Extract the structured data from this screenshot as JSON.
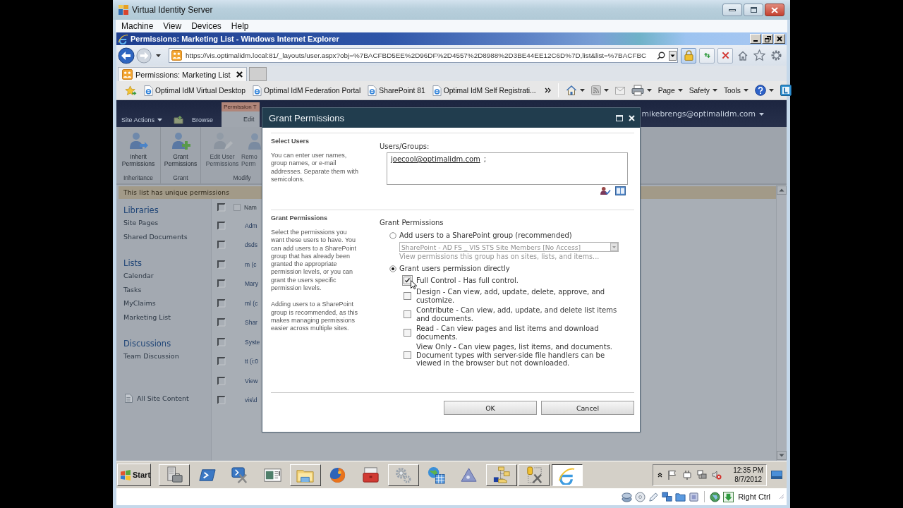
{
  "vm_window": {
    "title": "Virtual Identity Server",
    "menu": [
      "Machine",
      "View",
      "Devices",
      "Help"
    ]
  },
  "browser": {
    "title": "Permissions: Marketing List - Windows Internet Explorer",
    "address": "https://vis.optimalidm.local:81/_layouts/user.aspx?obj=%7BACFBD5EE%2D96DF%2D4557%2D8988%2D3BE44EE12C6D%7D,list&list=%7BACFBC",
    "tabs": [
      {
        "label": "Permissions: Marketing List",
        "selected": true
      }
    ],
    "favorites": [
      "Optimal IdM Virtual Desktop",
      "Optimal IdM Federation Portal",
      "SharePoint 81",
      "Optimal IdM Self Registrati..."
    ],
    "commands": [
      "Page",
      "Safety",
      "Tools"
    ]
  },
  "sharepoint": {
    "site_actions": "Site Actions",
    "ribbon_tabs": [
      {
        "label": "Browse",
        "selected": false
      }
    ],
    "contextual_group": {
      "title": "Permission T",
      "tabs": [
        {
          "label": "Edit",
          "selected": true
        }
      ]
    },
    "user": "mikebrengs@optimalidm.com",
    "ribbon_groups": [
      {
        "label": "Inheritance",
        "buttons": [
          {
            "kind": "inherit",
            "label": "Inherit Permissions",
            "disabled": false
          }
        ]
      },
      {
        "label": "Grant",
        "buttons": [
          {
            "kind": "grant",
            "label": "Grant Permissions",
            "disabled": false
          }
        ]
      },
      {
        "label": "Modify",
        "buttons": [
          {
            "kind": "edit",
            "label": "Edit User Permissions",
            "disabled": true
          },
          {
            "kind": "remove",
            "label": "Remo Perm",
            "disabled": true
          }
        ]
      }
    ],
    "notice": "This list has unique permissions",
    "nav": [
      {
        "heading": "Libraries",
        "items": [
          "Site Pages",
          "Shared Documents"
        ]
      },
      {
        "heading": "Lists",
        "items": [
          "Calendar",
          "Tasks",
          "MyClaims",
          "Marketing List"
        ]
      },
      {
        "heading": "Discussions",
        "items": [
          "Team Discussion"
        ]
      }
    ],
    "all_site_content": "All Site Content",
    "list": {
      "header": "Nam",
      "all_checked": false,
      "rows": [
        {
          "name": "Adm",
          "checked": false
        },
        {
          "name": "dsds",
          "checked": false
        },
        {
          "name": "m (c",
          "checked": false
        },
        {
          "name": "Mary",
          "checked": false
        },
        {
          "name": "ml (c",
          "checked": false
        },
        {
          "name": "Shar",
          "checked": false
        },
        {
          "name": "Syste",
          "checked": false
        },
        {
          "name": "tt (i:0",
          "checked": false
        },
        {
          "name": "View",
          "checked": false
        },
        {
          "name": "vis\\d",
          "checked": false
        }
      ]
    }
  },
  "dialog": {
    "title": "Grant Permissions",
    "select_users": {
      "heading": "Select Users",
      "description": "You can enter user names, group names, or e-mail addresses. Separate them with semicolons.",
      "field_label": "Users/Groups:",
      "users": [
        "joecool@optimalidm.com"
      ],
      "separator": ";"
    },
    "grant": {
      "heading": "Grant Permissions",
      "description": [
        "Select the permissions you want these users to have. You can add users to a SharePoint group that has already been granted the appropriate permission levels, or you can grant the users specific permission levels.",
        "Adding users to a SharePoint group is recommended, as this makes managing permissions easier across multiple sites."
      ],
      "field_label": "Grant Permissions",
      "group_option": {
        "label": "Add users to a SharePoint group (recommended)",
        "selected": false,
        "group": "SharePoint - AD FS _ VIS STS Site Members [No Access]",
        "group_disabled": true,
        "view_link": "View permissions this group has on sites, lists, and items..."
      },
      "direct_option": {
        "label": "Grant users permission directly",
        "selected": true
      },
      "permissions": [
        {
          "label": "Full Control - Has full control.",
          "checked": true,
          "focused": true
        },
        {
          "label": "Design - Can view, add, update, delete, approve, and customize.",
          "checked": false,
          "focused": false
        },
        {
          "label": "Contribute - Can view, add, update, and delete list items and documents.",
          "checked": false,
          "focused": false
        },
        {
          "label": "Read - Can view pages and list items and download documents.",
          "checked": false,
          "focused": false
        },
        {
          "label": "View Only - Can view pages, list items, and documents. Document types with server-side file handlers can be viewed in the browser but not downloaded.",
          "checked": false,
          "focused": false
        }
      ]
    },
    "buttons": [
      "OK",
      "Cancel"
    ]
  },
  "taskbar": {
    "start": "Start",
    "apps": [
      {
        "kind": "server",
        "open": true,
        "selected": false
      },
      {
        "kind": "shell",
        "open": false,
        "selected": false
      },
      {
        "kind": "shelltools",
        "open": false,
        "selected": false
      },
      {
        "kind": "viewer",
        "open": false,
        "selected": false
      },
      {
        "kind": "folder",
        "open": true,
        "selected": false
      },
      {
        "kind": "globe",
        "open": false,
        "selected": false
      },
      {
        "kind": "toolbox",
        "open": false,
        "selected": false
      },
      {
        "kind": "gears",
        "open": true,
        "selected": false
      },
      {
        "kind": "globemap",
        "open": false,
        "selected": false
      },
      {
        "kind": "triangle",
        "open": false,
        "selected": false
      },
      {
        "kind": "foldertree",
        "open": true,
        "selected": false
      },
      {
        "kind": "dbtools",
        "open": true,
        "selected": false
      },
      {
        "kind": "browser",
        "open": true,
        "selected": true
      }
    ],
    "time": "12:35 PM",
    "date": "8/7/2012"
  },
  "vm_status": {
    "host_key": "Right Ctrl"
  }
}
